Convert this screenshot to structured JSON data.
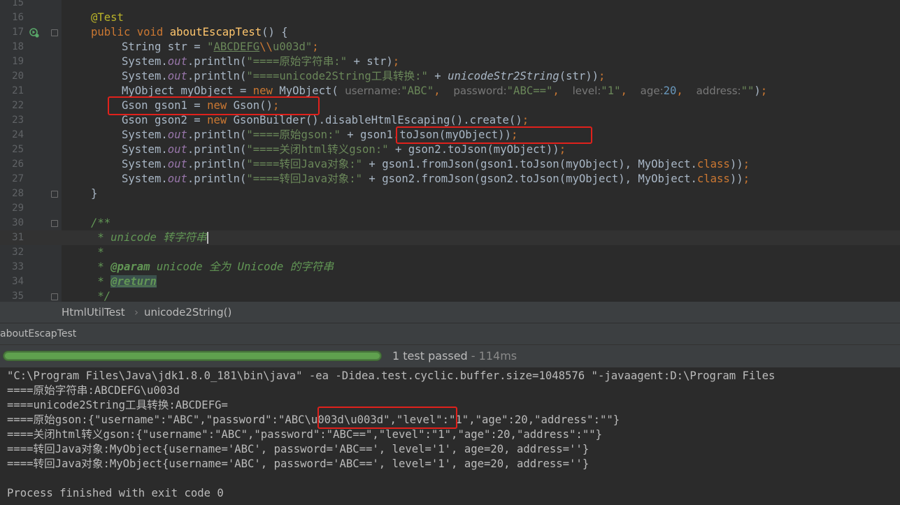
{
  "editor": {
    "line_numbers": [
      "15",
      "16",
      "17",
      "18",
      "19",
      "20",
      "21",
      "22",
      "23",
      "24",
      "25",
      "26",
      "27",
      "28",
      "29",
      "30",
      "31",
      "32",
      "33",
      "34",
      "35"
    ],
    "t": {
      "ann_test": "@Test",
      "public": "public",
      "void": "void",
      "method_name": "aboutEscapTest",
      "parens_brace": "() {",
      "string_type": "String str = ",
      "str_q1": "\"",
      "str_abc": "ABCDEFG",
      "str_esc": "\\\\",
      "str_rest": "u003d\"",
      "semicolon": ";",
      "system_dot": "System.",
      "out": "out",
      "println_open": ".println(",
      "s19": "\"====原始字符串:\"",
      "plus_str": " + str)",
      "s20": "\"====unicode2String工具转换:\"",
      "plus": " + ",
      "unicode_call": "unicodeStr2String",
      "str_close": "(str))",
      "myobject_decl": "MyObject myObject = ",
      "new": "new",
      "myobject_ctor": " MyObject(",
      "hint_username": "username:",
      "arg_abc": "\"ABC\"",
      "comma": ",",
      "hint_password": "password:",
      "arg_abceq": "\"ABC==\"",
      "hint_level": "level:",
      "arg_one": "\"1\"",
      "hint_age": "age:",
      "arg_20": "20",
      "hint_address": "address:",
      "arg_empty": "\"\"",
      "close_paren": ")",
      "gson1_decl": "Gson gson1 = ",
      "gson_ctor": " Gson()",
      "gson2_decl": "Gson gson2 = ",
      "gsonbuilder": " GsonBuilder().disableHtmlEscaping().create()",
      "s24": "\"====原始gson:\"",
      "tojson1": "gson1.toJson(myObject))",
      "s25": "\"====关闭html转义gson:\"",
      "tojson2": " + gson2.toJson(myObject))",
      "s26": "\"====转回Java对象:\"",
      "fromjson1": " + gson1.fromJson(gson1.toJson(myObject), MyObject.",
      "fromjson2": " + gson2.fromJson(gson2.toJson(myObject), MyObject.",
      "class": "class",
      "close2": "))",
      "close_brace": "}",
      "doc_open": "/**",
      "doc31": " * unicode 转字符串",
      "doc32": " *",
      "doc33_star": " * ",
      "doc_param": "@param",
      "doc33_rest": " unicode 全为 Unicode 的字符串",
      "doc34_star": " * ",
      "doc_return": "@return",
      "doc_close": " */"
    }
  },
  "breadcrumb": {
    "class": "HtmlUtilTest",
    "sep": "›",
    "method": "unicode2String()"
  },
  "run_tab": {
    "title": "aboutEscapTest"
  },
  "test_status": {
    "progress": 1.0,
    "result": "1 test passed",
    "duration": " - 114ms"
  },
  "console": {
    "lines": [
      "\"C:\\Program Files\\Java\\jdk1.8.0_181\\bin\\java\" -ea -Didea.test.cyclic.buffer.size=1048576 \"-javaagent:D:\\Program Files",
      "====原始字符串:ABCDEFG\\u003d",
      "====unicode2String工具转换:ABCDEFG=",
      "====原始gson:{\"username\":\"ABC\",\"password\":\"ABC\\u003d\\u003d\",\"level\":\"1\",\"age\":20,\"address\":\"\"}",
      "====关闭html转义gson:{\"username\":\"ABC\",\"password\":\"ABC==\",\"level\":\"1\",\"age\":20,\"address\":\"\"}",
      "====转回Java对象:MyObject{username='ABC', password='ABC==', level='1', age=20, address=''}",
      "====转回Java对象:MyObject{username='ABC', password='ABC==', level='1', age=20, address=''}",
      "",
      "Process finished with exit code 0"
    ]
  },
  "colors": {
    "highlight_box": "#e0211c",
    "progress_green": "#5fa04e",
    "editor_bg": "#2b2b2b"
  }
}
